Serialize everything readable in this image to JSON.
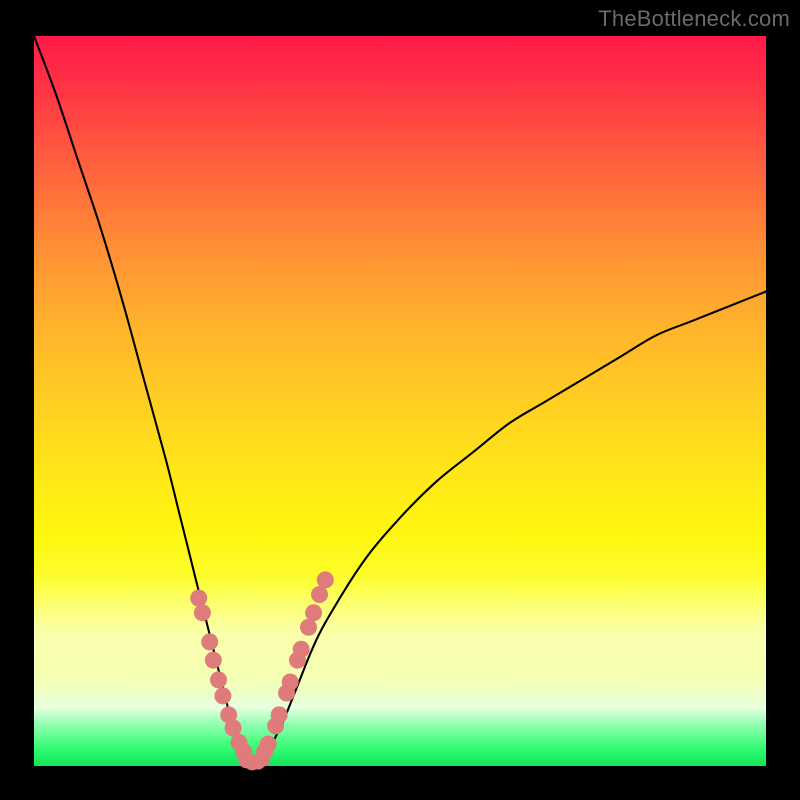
{
  "watermark": "TheBottleneck.com",
  "colors": {
    "frame": "#000000",
    "curve": "#000000",
    "dots": "#e07b7b"
  },
  "chart_data": {
    "type": "line",
    "title": "",
    "xlabel": "",
    "ylabel": "",
    "xlim": [
      0,
      100
    ],
    "ylim": [
      0,
      100
    ],
    "grid": false,
    "legend": false,
    "note": "Values read from a watermark-style bottleneck chart: a single V-shaped curve whose minimum (~0) is near x≈30; the left branch rises steeply toward 100 as x→0 and the right branch rises toward ~65 at x=100. Pink dots cluster around the minimum. y=0 at the bottom (green), y=100 at the top (red).",
    "series": [
      {
        "name": "curve",
        "x": [
          0,
          3,
          6,
          9,
          12,
          15,
          18,
          20,
          22,
          24,
          25,
          26,
          27,
          28,
          29,
          30,
          31,
          32,
          33,
          34,
          36,
          38,
          40,
          45,
          50,
          55,
          60,
          65,
          70,
          75,
          80,
          85,
          90,
          95,
          100
        ],
        "y": [
          100,
          92,
          83,
          74,
          64,
          53,
          42,
          34,
          26,
          18,
          14,
          10,
          6,
          3,
          1,
          0,
          1,
          2,
          4,
          6,
          11,
          16,
          20,
          28,
          34,
          39,
          43,
          47,
          50,
          53,
          56,
          59,
          61,
          63,
          65
        ]
      }
    ],
    "dots_left": {
      "desc": "pink dots on left limb near minimum",
      "x": [
        22.5,
        23.0,
        24.0,
        24.5,
        25.2,
        25.8,
        26.6,
        27.2,
        28.0,
        28.6
      ],
      "y": [
        23.0,
        21.0,
        17.0,
        14.5,
        11.8,
        9.6,
        7.0,
        5.2,
        3.2,
        2.0
      ]
    },
    "dots_right": {
      "desc": "pink dots on right limb near minimum",
      "x": [
        31.5,
        32.0,
        33.0,
        33.5,
        34.5,
        35.0,
        36.0,
        36.5,
        37.5,
        38.2,
        39.0,
        39.8
      ],
      "y": [
        2.0,
        3.0,
        5.5,
        7.0,
        10.0,
        11.5,
        14.5,
        16.0,
        19.0,
        21.0,
        23.5,
        25.5
      ]
    },
    "dots_bottom": {
      "desc": "pink dots along flat bottom of V",
      "x": [
        29.0,
        29.8,
        30.6,
        31.2
      ],
      "y": [
        0.8,
        0.5,
        0.6,
        1.0
      ]
    }
  }
}
